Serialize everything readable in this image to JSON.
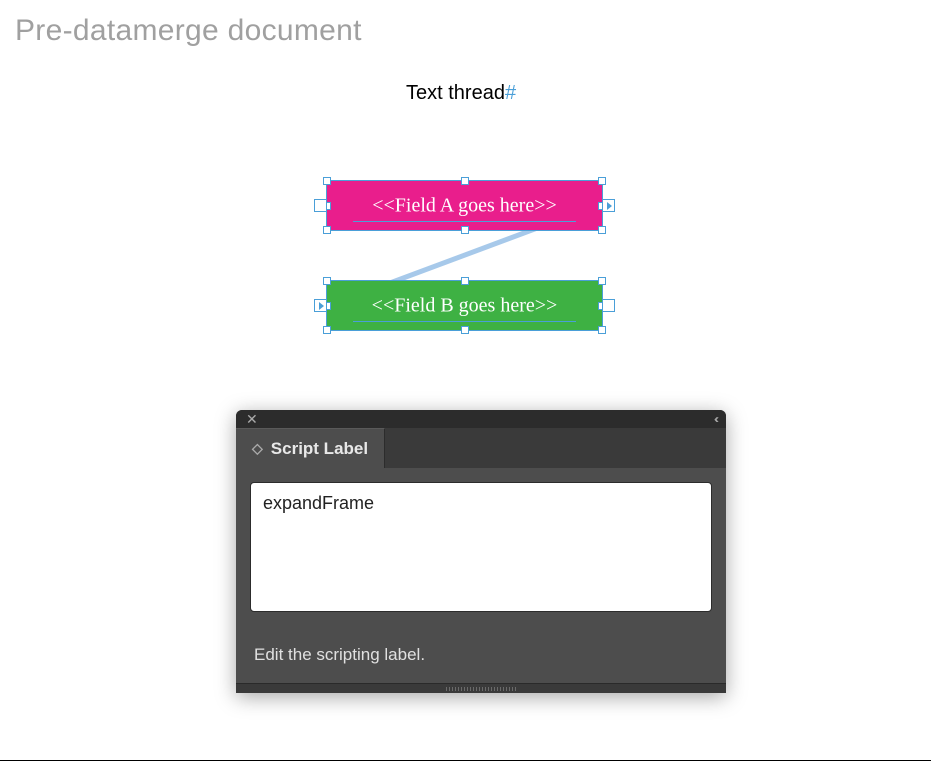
{
  "heading": "Pre-datamerge document",
  "textThread": {
    "label": "Text thread",
    "marker": "#"
  },
  "frames": {
    "fieldA": {
      "placeholder": "<<Field A goes here>>",
      "bgColor": "#e91e8c"
    },
    "fieldB": {
      "placeholder": "<<Field B goes here>>",
      "bgColor": "#3eb143"
    }
  },
  "panel": {
    "tabLabel": "Script Label",
    "value": "expandFrame",
    "hint": "Edit the scripting label."
  }
}
